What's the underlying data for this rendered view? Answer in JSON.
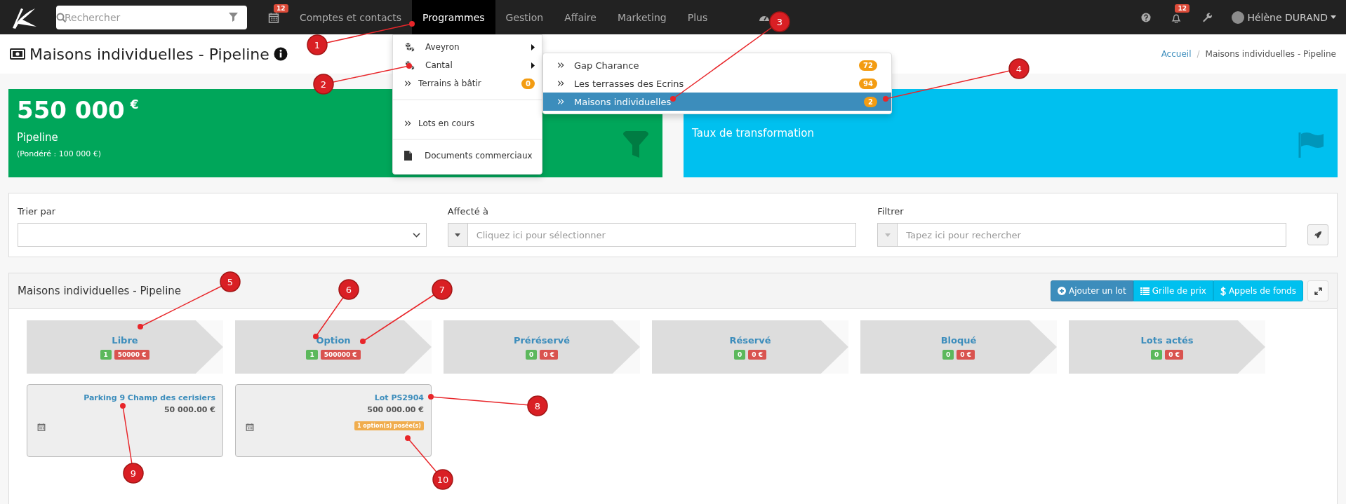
{
  "navbar": {
    "search": {
      "placeholder": "Rechercher"
    },
    "calendar_badge": "12",
    "menu": [
      {
        "label": "Comptes et contacts",
        "selected": false
      },
      {
        "label": "Programmes",
        "selected": true
      },
      {
        "label": "Gestion",
        "selected": false
      },
      {
        "label": "Affaire",
        "selected": false
      },
      {
        "label": "Marketing",
        "selected": false
      },
      {
        "label": "Plus",
        "selected": false
      }
    ],
    "notification_badge": "12",
    "user": "Hélène DURAND"
  },
  "dropdown": {
    "sections": [
      [
        {
          "kind": "submenu",
          "label": "Aveyron"
        },
        {
          "kind": "submenu",
          "label": "Cantal"
        },
        {
          "kind": "link",
          "label": "Terrains à bâtir",
          "badge": "0"
        }
      ],
      [
        {
          "kind": "link",
          "label": "Lots en cours"
        }
      ],
      [
        {
          "kind": "document",
          "label": "Documents commerciaux"
        }
      ]
    ]
  },
  "submenu": {
    "items": [
      {
        "label": "Gap Charance",
        "badge": "72",
        "selected": false
      },
      {
        "label": "Les terrasses des Ecrins",
        "badge": "94",
        "selected": false
      },
      {
        "label": "Maisons individuelles",
        "badge": "2",
        "selected": true
      }
    ]
  },
  "page": {
    "title": "Maisons individuelles - Pipeline",
    "breadcrumb_separator": "/",
    "breadcrumb": [
      {
        "label": "Accueil",
        "link": true
      },
      {
        "label": "Maisons individuelles - Pipeline",
        "link": false
      }
    ]
  },
  "kpis": [
    {
      "kind": "pipeline",
      "value": "550 000",
      "unit": "€",
      "label": "Pipeline",
      "sub": "(Pondéré : 100 000 €)",
      "color": "#00a65a"
    },
    {
      "kind": "rate",
      "label": "Taux de transformation",
      "color": "#00c0ef"
    }
  ],
  "filters": [
    {
      "kind": "select",
      "label": "Trier par"
    },
    {
      "kind": "combo",
      "label": "Affecté à",
      "placeholder": "Cliquez ici pour sélectionner"
    },
    {
      "kind": "search",
      "label": "Filtrer",
      "placeholder": "Tapez ici pour rechercher"
    }
  ],
  "pipeline": {
    "title": "Maisons individuelles - Pipeline",
    "buttons": [
      {
        "kind": "add",
        "label": "Ajouter un lot"
      },
      {
        "kind": "grid",
        "label": "Grille de prix"
      },
      {
        "kind": "funds",
        "label": "Appels de fonds"
      }
    ],
    "stages": [
      {
        "name": "Libre",
        "count": "1",
        "amount": "50000 €",
        "lots": [
          {
            "name": "Parking 9 Champ des cerisiers",
            "price": "50 000.00 €"
          }
        ]
      },
      {
        "name": "Option",
        "count": "1",
        "amount": "500000 €",
        "lots": [
          {
            "name": "Lot PS2904",
            "price": "500 000.00 €",
            "tag": "1 option(s) posée(s)"
          }
        ]
      },
      {
        "name": "Préréservé",
        "count": "0",
        "amount": "0 €"
      },
      {
        "name": "Réservé",
        "count": "0",
        "amount": "0 €"
      },
      {
        "name": "Bloqué",
        "count": "0",
        "amount": "0 €"
      },
      {
        "name": "Lots actés",
        "count": "0",
        "amount": "0 €"
      }
    ]
  },
  "annotations": [
    "1",
    "2",
    "3",
    "4",
    "5",
    "6",
    "7",
    "8",
    "9",
    "10"
  ]
}
